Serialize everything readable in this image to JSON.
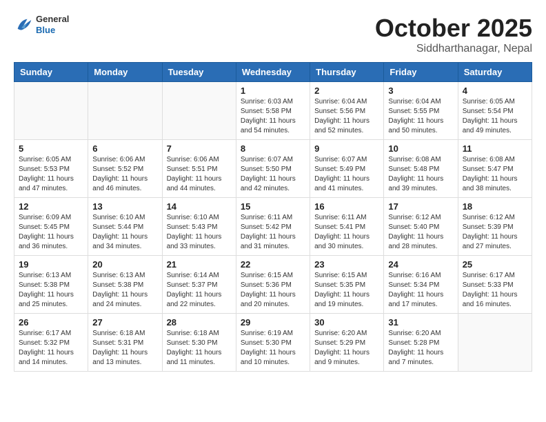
{
  "header": {
    "logo": {
      "general": "General",
      "blue": "Blue"
    },
    "title": "October 2025",
    "location": "Siddharthanagar, Nepal"
  },
  "weekdays": [
    "Sunday",
    "Monday",
    "Tuesday",
    "Wednesday",
    "Thursday",
    "Friday",
    "Saturday"
  ],
  "weeks": [
    [
      {
        "day": "",
        "info": ""
      },
      {
        "day": "",
        "info": ""
      },
      {
        "day": "",
        "info": ""
      },
      {
        "day": "1",
        "info": "Sunrise: 6:03 AM\nSunset: 5:58 PM\nDaylight: 11 hours\nand 54 minutes."
      },
      {
        "day": "2",
        "info": "Sunrise: 6:04 AM\nSunset: 5:56 PM\nDaylight: 11 hours\nand 52 minutes."
      },
      {
        "day": "3",
        "info": "Sunrise: 6:04 AM\nSunset: 5:55 PM\nDaylight: 11 hours\nand 50 minutes."
      },
      {
        "day": "4",
        "info": "Sunrise: 6:05 AM\nSunset: 5:54 PM\nDaylight: 11 hours\nand 49 minutes."
      }
    ],
    [
      {
        "day": "5",
        "info": "Sunrise: 6:05 AM\nSunset: 5:53 PM\nDaylight: 11 hours\nand 47 minutes."
      },
      {
        "day": "6",
        "info": "Sunrise: 6:06 AM\nSunset: 5:52 PM\nDaylight: 11 hours\nand 46 minutes."
      },
      {
        "day": "7",
        "info": "Sunrise: 6:06 AM\nSunset: 5:51 PM\nDaylight: 11 hours\nand 44 minutes."
      },
      {
        "day": "8",
        "info": "Sunrise: 6:07 AM\nSunset: 5:50 PM\nDaylight: 11 hours\nand 42 minutes."
      },
      {
        "day": "9",
        "info": "Sunrise: 6:07 AM\nSunset: 5:49 PM\nDaylight: 11 hours\nand 41 minutes."
      },
      {
        "day": "10",
        "info": "Sunrise: 6:08 AM\nSunset: 5:48 PM\nDaylight: 11 hours\nand 39 minutes."
      },
      {
        "day": "11",
        "info": "Sunrise: 6:08 AM\nSunset: 5:47 PM\nDaylight: 11 hours\nand 38 minutes."
      }
    ],
    [
      {
        "day": "12",
        "info": "Sunrise: 6:09 AM\nSunset: 5:45 PM\nDaylight: 11 hours\nand 36 minutes."
      },
      {
        "day": "13",
        "info": "Sunrise: 6:10 AM\nSunset: 5:44 PM\nDaylight: 11 hours\nand 34 minutes."
      },
      {
        "day": "14",
        "info": "Sunrise: 6:10 AM\nSunset: 5:43 PM\nDaylight: 11 hours\nand 33 minutes."
      },
      {
        "day": "15",
        "info": "Sunrise: 6:11 AM\nSunset: 5:42 PM\nDaylight: 11 hours\nand 31 minutes."
      },
      {
        "day": "16",
        "info": "Sunrise: 6:11 AM\nSunset: 5:41 PM\nDaylight: 11 hours\nand 30 minutes."
      },
      {
        "day": "17",
        "info": "Sunrise: 6:12 AM\nSunset: 5:40 PM\nDaylight: 11 hours\nand 28 minutes."
      },
      {
        "day": "18",
        "info": "Sunrise: 6:12 AM\nSunset: 5:39 PM\nDaylight: 11 hours\nand 27 minutes."
      }
    ],
    [
      {
        "day": "19",
        "info": "Sunrise: 6:13 AM\nSunset: 5:38 PM\nDaylight: 11 hours\nand 25 minutes."
      },
      {
        "day": "20",
        "info": "Sunrise: 6:13 AM\nSunset: 5:38 PM\nDaylight: 11 hours\nand 24 minutes."
      },
      {
        "day": "21",
        "info": "Sunrise: 6:14 AM\nSunset: 5:37 PM\nDaylight: 11 hours\nand 22 minutes."
      },
      {
        "day": "22",
        "info": "Sunrise: 6:15 AM\nSunset: 5:36 PM\nDaylight: 11 hours\nand 20 minutes."
      },
      {
        "day": "23",
        "info": "Sunrise: 6:15 AM\nSunset: 5:35 PM\nDaylight: 11 hours\nand 19 minutes."
      },
      {
        "day": "24",
        "info": "Sunrise: 6:16 AM\nSunset: 5:34 PM\nDaylight: 11 hours\nand 17 minutes."
      },
      {
        "day": "25",
        "info": "Sunrise: 6:17 AM\nSunset: 5:33 PM\nDaylight: 11 hours\nand 16 minutes."
      }
    ],
    [
      {
        "day": "26",
        "info": "Sunrise: 6:17 AM\nSunset: 5:32 PM\nDaylight: 11 hours\nand 14 minutes."
      },
      {
        "day": "27",
        "info": "Sunrise: 6:18 AM\nSunset: 5:31 PM\nDaylight: 11 hours\nand 13 minutes."
      },
      {
        "day": "28",
        "info": "Sunrise: 6:18 AM\nSunset: 5:30 PM\nDaylight: 11 hours\nand 11 minutes."
      },
      {
        "day": "29",
        "info": "Sunrise: 6:19 AM\nSunset: 5:30 PM\nDaylight: 11 hours\nand 10 minutes."
      },
      {
        "day": "30",
        "info": "Sunrise: 6:20 AM\nSunset: 5:29 PM\nDaylight: 11 hours\nand 9 minutes."
      },
      {
        "day": "31",
        "info": "Sunrise: 6:20 AM\nSunset: 5:28 PM\nDaylight: 11 hours\nand 7 minutes."
      },
      {
        "day": "",
        "info": ""
      }
    ]
  ]
}
